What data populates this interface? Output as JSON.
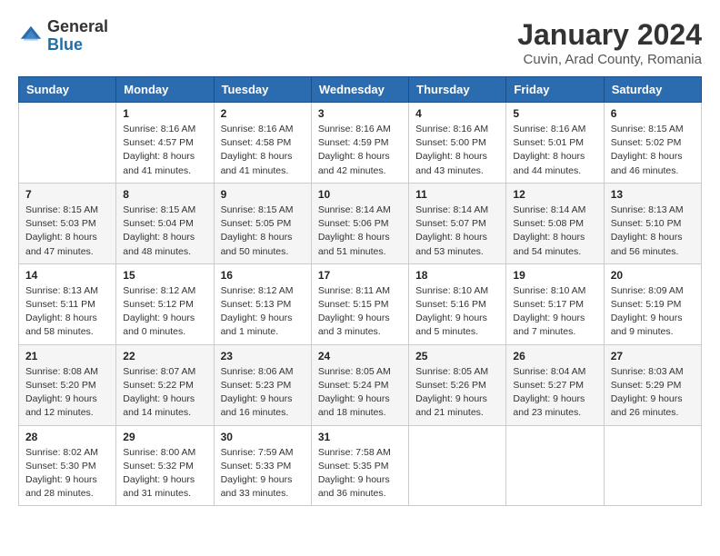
{
  "header": {
    "logo_general": "General",
    "logo_blue": "Blue",
    "month_title": "January 2024",
    "location": "Cuvin, Arad County, Romania"
  },
  "days_of_week": [
    "Sunday",
    "Monday",
    "Tuesday",
    "Wednesday",
    "Thursday",
    "Friday",
    "Saturday"
  ],
  "weeks": [
    [
      {
        "day": "",
        "info": ""
      },
      {
        "day": "1",
        "info": "Sunrise: 8:16 AM\nSunset: 4:57 PM\nDaylight: 8 hours\nand 41 minutes."
      },
      {
        "day": "2",
        "info": "Sunrise: 8:16 AM\nSunset: 4:58 PM\nDaylight: 8 hours\nand 41 minutes."
      },
      {
        "day": "3",
        "info": "Sunrise: 8:16 AM\nSunset: 4:59 PM\nDaylight: 8 hours\nand 42 minutes."
      },
      {
        "day": "4",
        "info": "Sunrise: 8:16 AM\nSunset: 5:00 PM\nDaylight: 8 hours\nand 43 minutes."
      },
      {
        "day": "5",
        "info": "Sunrise: 8:16 AM\nSunset: 5:01 PM\nDaylight: 8 hours\nand 44 minutes."
      },
      {
        "day": "6",
        "info": "Sunrise: 8:15 AM\nSunset: 5:02 PM\nDaylight: 8 hours\nand 46 minutes."
      }
    ],
    [
      {
        "day": "7",
        "info": "Sunrise: 8:15 AM\nSunset: 5:03 PM\nDaylight: 8 hours\nand 47 minutes."
      },
      {
        "day": "8",
        "info": "Sunrise: 8:15 AM\nSunset: 5:04 PM\nDaylight: 8 hours\nand 48 minutes."
      },
      {
        "day": "9",
        "info": "Sunrise: 8:15 AM\nSunset: 5:05 PM\nDaylight: 8 hours\nand 50 minutes."
      },
      {
        "day": "10",
        "info": "Sunrise: 8:14 AM\nSunset: 5:06 PM\nDaylight: 8 hours\nand 51 minutes."
      },
      {
        "day": "11",
        "info": "Sunrise: 8:14 AM\nSunset: 5:07 PM\nDaylight: 8 hours\nand 53 minutes."
      },
      {
        "day": "12",
        "info": "Sunrise: 8:14 AM\nSunset: 5:08 PM\nDaylight: 8 hours\nand 54 minutes."
      },
      {
        "day": "13",
        "info": "Sunrise: 8:13 AM\nSunset: 5:10 PM\nDaylight: 8 hours\nand 56 minutes."
      }
    ],
    [
      {
        "day": "14",
        "info": "Sunrise: 8:13 AM\nSunset: 5:11 PM\nDaylight: 8 hours\nand 58 minutes."
      },
      {
        "day": "15",
        "info": "Sunrise: 8:12 AM\nSunset: 5:12 PM\nDaylight: 9 hours\nand 0 minutes."
      },
      {
        "day": "16",
        "info": "Sunrise: 8:12 AM\nSunset: 5:13 PM\nDaylight: 9 hours\nand 1 minute."
      },
      {
        "day": "17",
        "info": "Sunrise: 8:11 AM\nSunset: 5:15 PM\nDaylight: 9 hours\nand 3 minutes."
      },
      {
        "day": "18",
        "info": "Sunrise: 8:10 AM\nSunset: 5:16 PM\nDaylight: 9 hours\nand 5 minutes."
      },
      {
        "day": "19",
        "info": "Sunrise: 8:10 AM\nSunset: 5:17 PM\nDaylight: 9 hours\nand 7 minutes."
      },
      {
        "day": "20",
        "info": "Sunrise: 8:09 AM\nSunset: 5:19 PM\nDaylight: 9 hours\nand 9 minutes."
      }
    ],
    [
      {
        "day": "21",
        "info": "Sunrise: 8:08 AM\nSunset: 5:20 PM\nDaylight: 9 hours\nand 12 minutes."
      },
      {
        "day": "22",
        "info": "Sunrise: 8:07 AM\nSunset: 5:22 PM\nDaylight: 9 hours\nand 14 minutes."
      },
      {
        "day": "23",
        "info": "Sunrise: 8:06 AM\nSunset: 5:23 PM\nDaylight: 9 hours\nand 16 minutes."
      },
      {
        "day": "24",
        "info": "Sunrise: 8:05 AM\nSunset: 5:24 PM\nDaylight: 9 hours\nand 18 minutes."
      },
      {
        "day": "25",
        "info": "Sunrise: 8:05 AM\nSunset: 5:26 PM\nDaylight: 9 hours\nand 21 minutes."
      },
      {
        "day": "26",
        "info": "Sunrise: 8:04 AM\nSunset: 5:27 PM\nDaylight: 9 hours\nand 23 minutes."
      },
      {
        "day": "27",
        "info": "Sunrise: 8:03 AM\nSunset: 5:29 PM\nDaylight: 9 hours\nand 26 minutes."
      }
    ],
    [
      {
        "day": "28",
        "info": "Sunrise: 8:02 AM\nSunset: 5:30 PM\nDaylight: 9 hours\nand 28 minutes."
      },
      {
        "day": "29",
        "info": "Sunrise: 8:00 AM\nSunset: 5:32 PM\nDaylight: 9 hours\nand 31 minutes."
      },
      {
        "day": "30",
        "info": "Sunrise: 7:59 AM\nSunset: 5:33 PM\nDaylight: 9 hours\nand 33 minutes."
      },
      {
        "day": "31",
        "info": "Sunrise: 7:58 AM\nSunset: 5:35 PM\nDaylight: 9 hours\nand 36 minutes."
      },
      {
        "day": "",
        "info": ""
      },
      {
        "day": "",
        "info": ""
      },
      {
        "day": "",
        "info": ""
      }
    ]
  ]
}
